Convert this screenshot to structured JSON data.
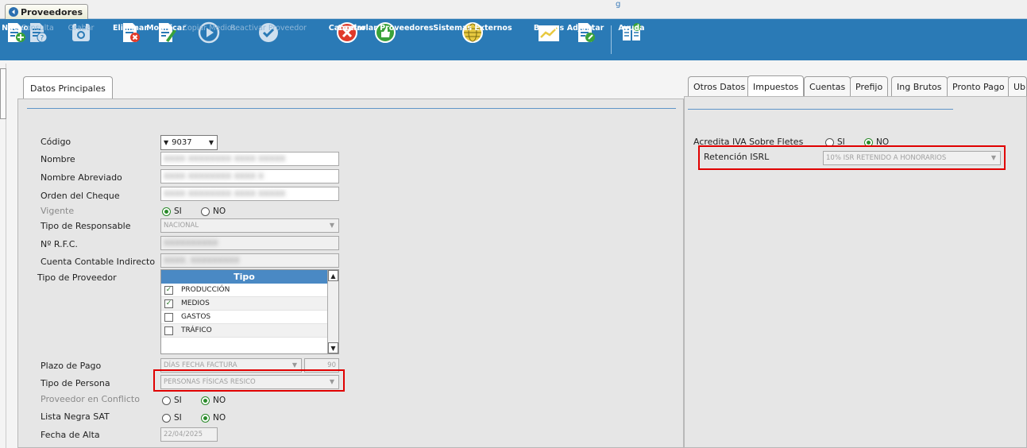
{
  "window": {
    "title": "Proveedores"
  },
  "toolbar": {
    "buttons": [
      {
        "label": "Nuevo",
        "icon": "new-doc-icon",
        "enabled": true
      },
      {
        "label": "Consulta",
        "icon": "query-doc-icon",
        "enabled": false
      },
      {
        "label": "Grabar",
        "icon": "save-icon",
        "enabled": false
      },
      {
        "label": "Eliminar",
        "icon": "delete-doc-icon",
        "enabled": true
      },
      {
        "label": "Modificar",
        "icon": "edit-doc-icon",
        "enabled": true
      },
      {
        "label": "Copiar Medios",
        "icon": "play-circle-icon",
        "enabled": false
      },
      {
        "label": "Reactivar Proveedor",
        "icon": "check-circle-icon",
        "enabled": false
      },
      {
        "label": "Cancelar",
        "icon": "cancel-circle-icon",
        "enabled": true
      },
      {
        "label": "Controlar Proveedores",
        "icon": "thumbs-up-icon",
        "enabled": true
      },
      {
        "label": "Sistemas Externos",
        "icon": "globe-icon",
        "enabled": true
      },
      {
        "label": "Bancos",
        "icon": "chart-icon",
        "enabled": true
      },
      {
        "label": "Adjuntar",
        "icon": "attach-doc-icon",
        "enabled": true
      },
      {
        "label": "Ayuda",
        "icon": "help-book-icon",
        "enabled": true
      }
    ]
  },
  "left_panel": {
    "tab": "Datos Principales",
    "fields": {
      "codigo_label": "Código",
      "codigo_value": "9037",
      "nombre_label": "Nombre",
      "nombre_value": "XXXX XXXXXXXX XXXX XXXXX",
      "nombre_abreviado_label": "Nombre Abreviado",
      "nombre_abreviado_value": "XXXX XXXXXXXX XXXX X",
      "orden_cheque_label": "Orden del Cheque",
      "orden_cheque_value": "XXXX XXXXXXXX XXXX XXXXX",
      "vigente_label": "Vigente",
      "tipo_responsable_label": "Tipo de Responsable",
      "tipo_responsable_value": "NACIONAL",
      "rfc_label": "Nº R.F.C.",
      "rfc_value": "XXXXXXXXXX",
      "cuenta_contable_label": "Cuenta Contable Indirecto",
      "cuenta_contable_value": "XXXX. XXXXXXXXX",
      "tipo_proveedor_label": "Tipo de Proveedor",
      "plazo_pago_label": "Plazo de Pago",
      "plazo_pago_value": "DÍAS FECHA FACTURA",
      "plazo_pago_days": "90",
      "tipo_persona_label": "Tipo de Persona",
      "tipo_persona_value": "PERSONAS FÍSICAS RESICO",
      "proveedor_conflicto_label": "Proveedor en Conflicto",
      "lista_negra_label": "Lista Negra SAT",
      "fecha_alta_label": "Fecha de Alta",
      "fecha_alta_value": "22/04/2025"
    },
    "radio": {
      "si": "SI",
      "no": "NO"
    },
    "tipo_grid": {
      "header": "Tipo",
      "rows": [
        {
          "label": "PRODUCCIÓN",
          "checked": "✓"
        },
        {
          "label": "MEDIOS",
          "checked": "✓"
        },
        {
          "label": "GASTOS",
          "checked": ""
        },
        {
          "label": "TRÁFICO",
          "checked": ""
        }
      ]
    }
  },
  "right_panel": {
    "tabs": [
      "Otros Datos",
      "Impuestos",
      "Cuentas",
      "Prefijo",
      "Ing Brutos",
      "Pronto Pago",
      "Ub"
    ],
    "active_tab": "Impuestos",
    "acredita_iva_label": "Acredita IVA Sobre Fletes",
    "retencion_isrl_label": "Retención ISRL",
    "retencion_isrl_value": "10% ISR RETENIDO A HONORARIOS"
  },
  "colors": {
    "toolbar_bg": "#2a7ab6",
    "header_blue": "#4a89c4",
    "highlight_red": "#e00000"
  }
}
